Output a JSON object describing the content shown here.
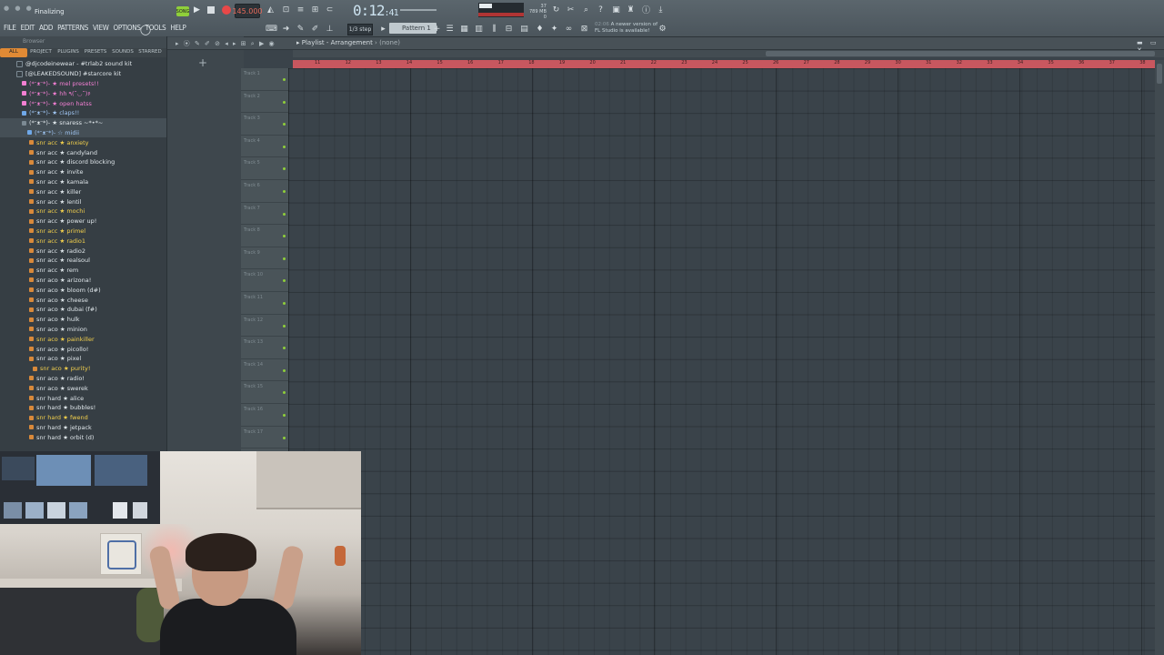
{
  "window": {
    "status_text": "Finalizing"
  },
  "menu": [
    "FILE",
    "EDIT",
    "ADD",
    "PATTERNS",
    "VIEW",
    "OPTIONS",
    "TOOLS",
    "HELP"
  ],
  "transport": {
    "mode_label": "SONG",
    "bpm": "145.000",
    "time_main": "0:12",
    "time_sub": ":41",
    "step_label": "1/3 step",
    "pattern_label": "Pattern 1",
    "cpu_value": "37",
    "mem_value": "789 MB",
    "mem_sub": "0"
  },
  "news": {
    "line1": "A newer version of",
    "line2": "FL Studio is available!",
    "hint": "02:06"
  },
  "browser": {
    "title": "Browser",
    "tabs": [
      "ALL",
      "PROJECT",
      "PLUGINS",
      "PRESETS",
      "SOUNDS",
      "STARRED"
    ],
    "items": [
      {
        "label": "@djcodeinewear - #trlab2 sound kit",
        "color": "wh",
        "indent": 18
      },
      {
        "label": "[@LEAKEDSOUND] #starcore kit",
        "color": "wh",
        "indent": 18
      },
      {
        "label": "(*ᵔᴥᵔ*)- ★ mel presets!!",
        "color": "pk",
        "indent": 24
      },
      {
        "label": "(*ᵔᴥᵔ*)- ★ hh ٩(˘◡˘)۶",
        "color": "pk",
        "indent": 24
      },
      {
        "label": "(*ᵔᴥᵔ*)- ★ open hatss",
        "color": "pk",
        "indent": 24
      },
      {
        "label": "(*ᵔᴥᵔ*)- ★ claps!!",
        "color": "lb",
        "indent": 24
      },
      {
        "label": "(*ᵔᴥᵔ*)- ★ snaress ~*•*~",
        "color": "wh",
        "indent": 24
      },
      {
        "label": "(*ᵔᴥᵔ*)- ☆ midii",
        "color": "lb",
        "indent": 30
      },
      {
        "label": "snr acc ★ anxiety",
        "color": "hl",
        "indent": 32
      },
      {
        "label": "snr acc ★ candyland",
        "color": "wh",
        "indent": 32
      },
      {
        "label": "snr acc ★ discord blocking",
        "color": "wh",
        "indent": 32
      },
      {
        "label": "snr acc ★ invite",
        "color": "wh",
        "indent": 32
      },
      {
        "label": "snr acc ★ kamala",
        "color": "wh",
        "indent": 32
      },
      {
        "label": "snr acc ★ killer",
        "color": "wh",
        "indent": 32
      },
      {
        "label": "snr acc ★ lentil",
        "color": "wh",
        "indent": 32
      },
      {
        "label": "snr acc ★ mochi",
        "color": "hl",
        "indent": 32
      },
      {
        "label": "snr acc ★ power up!",
        "color": "wh",
        "indent": 32
      },
      {
        "label": "snr acc ★ primel",
        "color": "hl",
        "indent": 32
      },
      {
        "label": "snr acc ★ radio1",
        "color": "hl",
        "indent": 32
      },
      {
        "label": "snr acc ★ radio2",
        "color": "wh",
        "indent": 32
      },
      {
        "label": "snr acc ★ realsoul",
        "color": "wh",
        "indent": 32
      },
      {
        "label": "snr acc ★ rem",
        "color": "wh",
        "indent": 32
      },
      {
        "label": "snr aco ★ arizona!",
        "color": "wh",
        "indent": 32
      },
      {
        "label": "snr aco ★ bloom (d#)",
        "color": "wh",
        "indent": 32
      },
      {
        "label": "snr aco ★ cheese",
        "color": "wh",
        "indent": 32
      },
      {
        "label": "snr aco ★ dubai (f#)",
        "color": "wh",
        "indent": 32
      },
      {
        "label": "snr aco ★ hulk",
        "color": "wh",
        "indent": 32
      },
      {
        "label": "snr aco ★ minion",
        "color": "wh",
        "indent": 32
      },
      {
        "label": "snr aco ★ painkiller",
        "color": "hl",
        "indent": 32
      },
      {
        "label": "snr aco ★ picollo!",
        "color": "wh",
        "indent": 32
      },
      {
        "label": "snr aco ★ pixel",
        "color": "wh",
        "indent": 32
      },
      {
        "label": "snr aco ★ purity!",
        "color": "hl",
        "indent": 36
      },
      {
        "label": "snr aco ★ radio!",
        "color": "wh",
        "indent": 32
      },
      {
        "label": "snr aco ★ swerek",
        "color": "wh",
        "indent": 32
      },
      {
        "label": "snr hard ★ alice",
        "color": "wh",
        "indent": 32
      },
      {
        "label": "snr hard ★ bubbles!",
        "color": "wh",
        "indent": 32
      },
      {
        "label": "snr hard ★ fwend",
        "color": "hl",
        "indent": 32
      },
      {
        "label": "snr hard ★ jetpack",
        "color": "wh",
        "indent": 32
      },
      {
        "label": "snr hard ★ orbit (d)",
        "color": "wh",
        "indent": 32
      }
    ]
  },
  "playlist": {
    "title": "Playlist - Arrangement",
    "subtitle": "(none)",
    "bar_numbers": [
      "11",
      "12",
      "13",
      "14",
      "15",
      "16",
      "17",
      "18",
      "19",
      "20",
      "21",
      "22",
      "23",
      "24",
      "25",
      "26",
      "27",
      "28",
      "29",
      "30",
      "31",
      "32",
      "33",
      "34",
      "35",
      "36",
      "37",
      "38"
    ],
    "tracks": [
      "Track 1",
      "Track 2",
      "Track 3",
      "Track 4",
      "Track 5",
      "Track 6",
      "Track 7",
      "Track 8",
      "Track 9",
      "Track 10",
      "Track 11",
      "Track 12",
      "Track 13",
      "Track 14",
      "Track 15",
      "Track 16",
      "Track 17"
    ]
  }
}
